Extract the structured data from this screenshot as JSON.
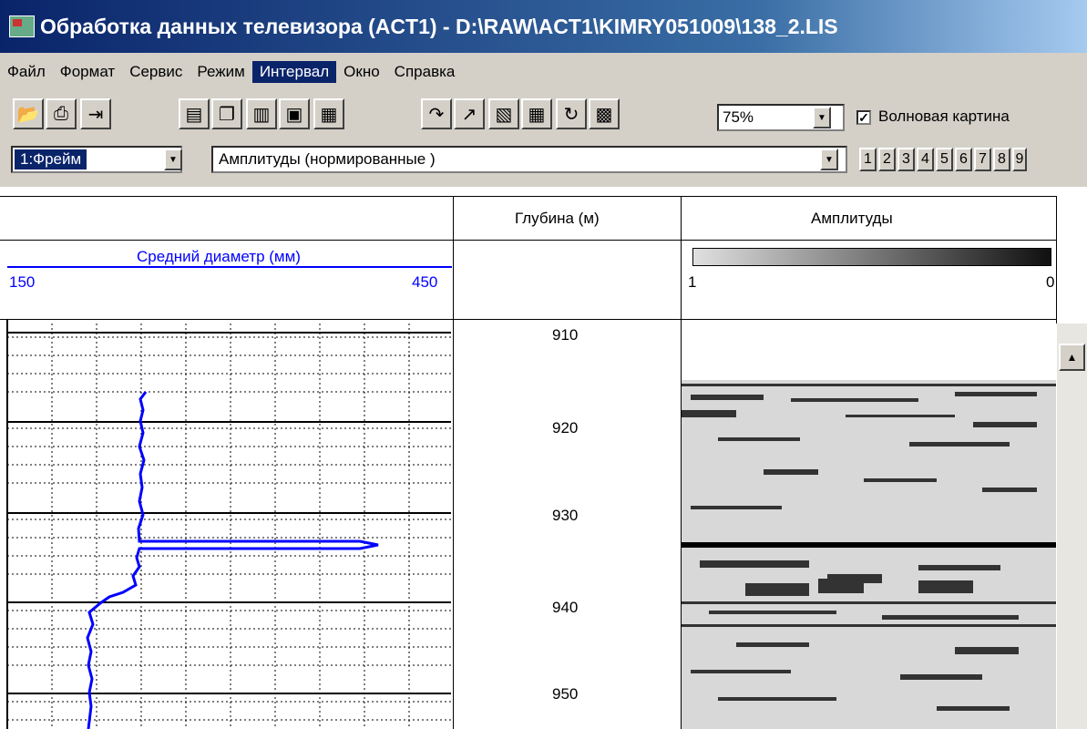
{
  "window": {
    "title": "Обработка данных телевизора (ACT1) - D:\\RAW\\ACT1\\KIMRY051009\\138_2.LIS"
  },
  "menu": [
    "Файл",
    "Формат",
    "Сервис",
    "Режим",
    "Интервал",
    "Окно",
    "Справка"
  ],
  "menu_active_index": 4,
  "toolbar": {
    "zoom_value": "75%",
    "wave_checkbox_checked": true,
    "wave_label": "Волновая картина"
  },
  "frame_select": {
    "value": "1:Фрейм"
  },
  "amplitude_select": {
    "value": "Амплитуды (нормированные )"
  },
  "pages": [
    "1",
    "2",
    "3",
    "4",
    "5",
    "6",
    "7",
    "8",
    "9"
  ],
  "track1": {
    "header": "",
    "curve_name": "Средний диаметр (мм)",
    "scale_min": "150",
    "scale_max": "450",
    "color": "#0000ff"
  },
  "depth_track": {
    "header": "Глубина (м)",
    "labels": [
      "910",
      "920",
      "930",
      "940",
      "950"
    ]
  },
  "image_track": {
    "header": "Амплитуды",
    "scale_left": "1",
    "scale_right": "0"
  }
}
